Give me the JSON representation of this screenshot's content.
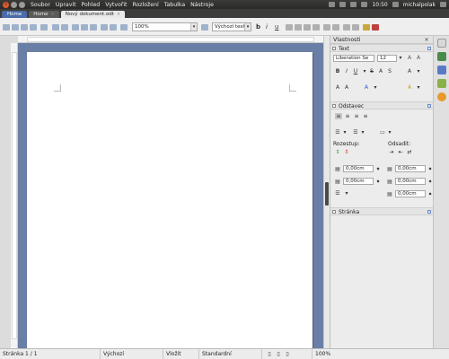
{
  "menubar": {
    "items": [
      "Soubor",
      "Upravit",
      "Pohled",
      "Vytvořit",
      "Rozložení",
      "Tabulka",
      "Nástroje"
    ],
    "clock": "10:50",
    "user": "michalpolak"
  },
  "tabs": {
    "first": "Home",
    "second": "Home",
    "active": "Nový dokument.odt"
  },
  "toolbar": {
    "zoom": "100%",
    "style": "Výchozí text",
    "bold": "b",
    "italic": "i",
    "underline": "u"
  },
  "sidebar": {
    "title": "Vlastnosti",
    "text_section": "Text",
    "font_name": "Liberation Se",
    "font_size": "12",
    "paragraph_section": "Odstavec",
    "spacing_label": "Rozestup:",
    "indent_label": "Odsadit:",
    "spacing_values": [
      "0,00cm",
      "0,00cm"
    ],
    "indent_values": [
      "0,00cm",
      "0,00cm",
      "0,00cm"
    ],
    "page_section": "Stránka"
  },
  "status": {
    "page": "Stránka 1 / 1",
    "style": "Výchozí",
    "mode": "Vložit",
    "selection": "Standardní",
    "zoom": "100%"
  }
}
